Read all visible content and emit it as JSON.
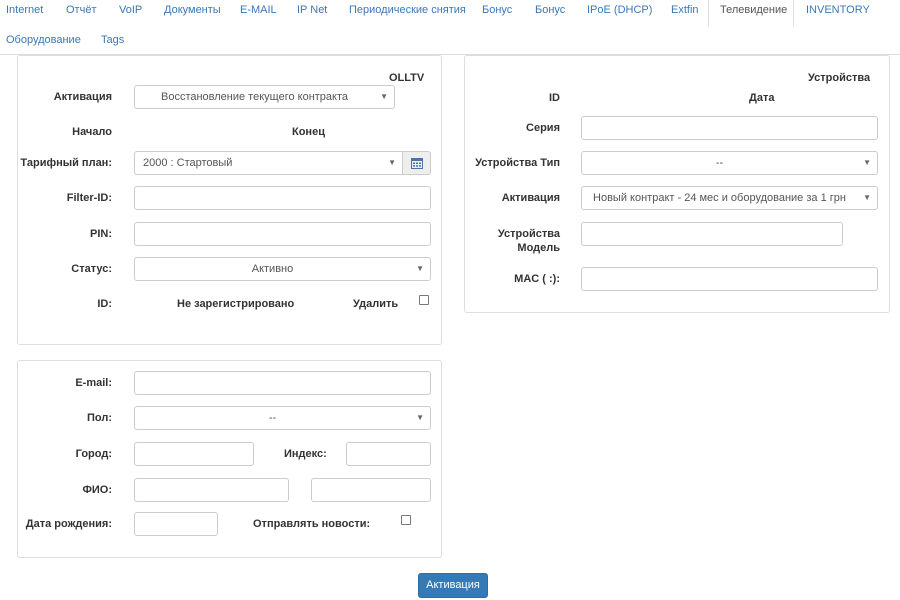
{
  "tabs": [
    {
      "label": "Internet"
    },
    {
      "label": "Отчёт"
    },
    {
      "label": "VoIP"
    },
    {
      "label": "Документы"
    },
    {
      "label": "E-MAIL"
    },
    {
      "label": "IP Net"
    },
    {
      "label": "Периодические снятия"
    },
    {
      "label": "Бонус"
    },
    {
      "label": "Бонус"
    },
    {
      "label": "IPoE (DHCP)"
    },
    {
      "label": "Extfin"
    },
    {
      "label": "Телевидение",
      "active": true
    },
    {
      "label": "INVENTORY"
    },
    {
      "label": "Оборудование"
    },
    {
      "label": "Tags"
    }
  ],
  "olltv": {
    "title": "OLLTV",
    "activation_label": "Активация",
    "activation_value": "Восстановление текущего контракта",
    "start_label": "Начало",
    "end_label": "Конец",
    "tariff_label": "Тарифный план:",
    "tariff_value": "2000 : Стартовый",
    "filter_label": "Filter-ID:",
    "filter_value": "",
    "pin_label": "PIN:",
    "pin_value": "",
    "status_label": "Статус:",
    "status_value": "Активно",
    "id_label": "ID:",
    "id_value": "Не зарегистрировано",
    "delete_label": "Удалить"
  },
  "devices": {
    "title": "Устройства",
    "id_label": "ID",
    "date_label": "Дата",
    "serial_label": "Серия",
    "serial_value": "",
    "type_label": "Устройства Тип",
    "type_value": "--",
    "activation_label": "Активация",
    "activation_value": "Новый контракт - 24 мес и оборудование за 1 грн",
    "model_label_1": "Устройства",
    "model_label_2": "Модель",
    "model_value": "",
    "mac_label": "MAC ( :):",
    "mac_value": ""
  },
  "personal": {
    "email_label": "E-mail:",
    "email_value": "",
    "gender_label": "Пол:",
    "gender_value": "--",
    "city_label": "Город:",
    "city_value": "",
    "index_label": "Индекс:",
    "index_value": "",
    "fio_label": "ФИО:",
    "fio_value_1": "",
    "fio_value_2": "",
    "birth_label": "Дата рождения:",
    "birth_value": "",
    "news_label": "Отправлять новости:"
  },
  "submit_label": "Активация",
  "colors": {
    "link": "#3a78b6",
    "primary": "#337ab7"
  }
}
